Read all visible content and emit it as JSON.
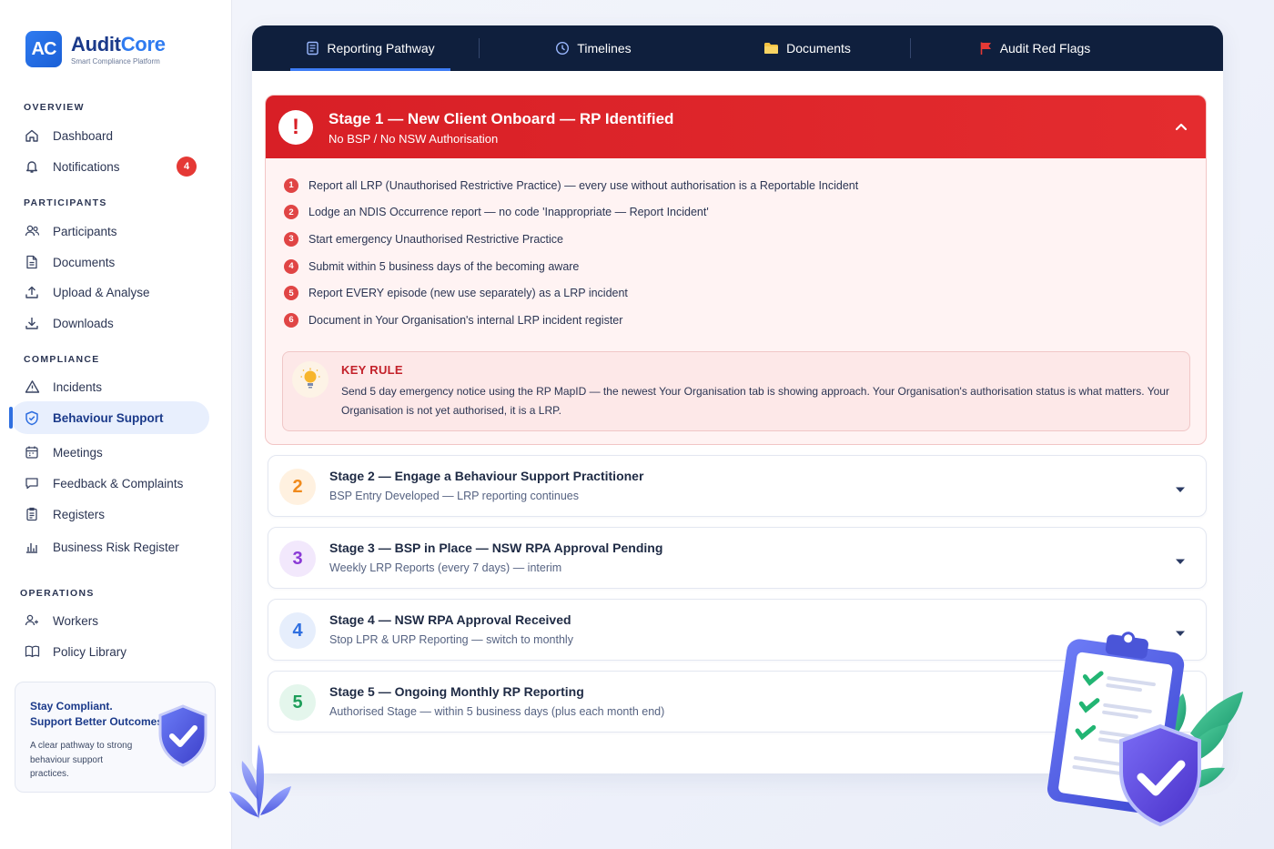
{
  "brand": {
    "logo_text": "AC",
    "name_part1": "Audit",
    "name_part2": "Core",
    "tagline": "Smart Compliance Platform"
  },
  "sidebar": {
    "sections": [
      {
        "title": "OVERVIEW"
      },
      {
        "title": "PARTICIPANTS"
      },
      {
        "title": "COMPLIANCE"
      },
      {
        "title": "OPERATIONS"
      }
    ],
    "items": [
      {
        "label": "Dashboard",
        "icon": "home-icon"
      },
      {
        "label": "Notifications",
        "icon": "bell-icon",
        "badge": "4"
      },
      {
        "label": "Participants",
        "icon": "users-icon"
      },
      {
        "label": "Documents",
        "icon": "document-icon"
      },
      {
        "label": "Upload & Analyse",
        "icon": "upload-icon"
      },
      {
        "label": "Downloads",
        "icon": "download-icon"
      },
      {
        "label": "Incidents",
        "icon": "warning-icon"
      },
      {
        "label": "Behaviour Support",
        "icon": "shield-icon",
        "active": true
      },
      {
        "label": "Meetings",
        "icon": "calendar-icon"
      },
      {
        "label": "Feedback & Complaints",
        "icon": "chat-icon"
      },
      {
        "label": "Registers",
        "icon": "clipboard-icon"
      },
      {
        "label": "Business Risk Register",
        "icon": "bar-chart-icon"
      },
      {
        "label": "Workers",
        "icon": "workers-icon"
      },
      {
        "label": "Policy Library",
        "icon": "book-icon"
      }
    ],
    "promo": {
      "title_line1": "Stay Compliant.",
      "title_line2": "Support Better Outcomes.",
      "subtitle": "A clear pathway to strong behaviour support practices."
    }
  },
  "tabs": [
    {
      "label": "Reporting Pathway",
      "icon": "report-icon",
      "active": true
    },
    {
      "label": "Timelines",
      "icon": "clock-icon"
    },
    {
      "label": "Documents",
      "icon": "folder-icon"
    },
    {
      "label": "Audit Red Flags",
      "icon": "flag-icon"
    }
  ],
  "stage1": {
    "alert_symbol": "!",
    "title": "Stage 1 — New Client Onboard — RP Identified",
    "subtitle": "No BSP / No NSW Authorisation",
    "steps": [
      {
        "num": "1",
        "text": "Report all LRP (Unauthorised Restrictive Practice) — every use without authorisation is a Reportable Incident"
      },
      {
        "num": "2",
        "text": "Lodge an NDIS Occurrence report — no code 'Inappropriate — Report Incident'"
      },
      {
        "num": "3",
        "text": "Start emergency Unauthorised Restrictive Practice"
      },
      {
        "num": "4",
        "text": "Submit within 5 business days of the becoming aware"
      },
      {
        "num": "5",
        "text": "Report EVERY episode (new use separately) as a LRP incident"
      },
      {
        "num": "6",
        "text": "Document in Your Organisation's internal LRP incident register"
      }
    ],
    "key_rule": {
      "title": "KEY RULE",
      "text": "Send 5 day emergency notice using the RP MapID — the newest Your Organisation tab is showing approach. Your Organisation's authorisation status is what matters. Your Organisation is not yet authorised, it is a LRP."
    }
  },
  "stages": [
    {
      "num": "2",
      "title": "Stage 2 — Engage a Behaviour Support Practitioner",
      "subtitle": "BSP Entry Developed — LRP reporting continues",
      "color": "#f08a1c",
      "bg": "#fff1e0"
    },
    {
      "num": "3",
      "title": "Stage 3 — BSP in Place — NSW RPA Approval Pending",
      "subtitle": "Weekly LRP Reports (every 7 days) — interim",
      "color": "#8a3ad6",
      "bg": "#f2e8fc"
    },
    {
      "num": "4",
      "title": "Stage 4 — NSW RPA Approval Received",
      "subtitle": "Stop LPR & URP Reporting — switch to monthly",
      "color": "#2f6fe0",
      "bg": "#e6eefc"
    },
    {
      "num": "5",
      "title": "Stage 5 — Ongoing Monthly RP Reporting",
      "subtitle": "Authorised Stage — within 5 business days (plus each month end)",
      "color": "#1e9e5a",
      "bg": "#e4f6ec"
    }
  ],
  "colors": {
    "primary": "#2f6fe0",
    "navy": "#0f1f3d",
    "danger": "#d81f26"
  }
}
